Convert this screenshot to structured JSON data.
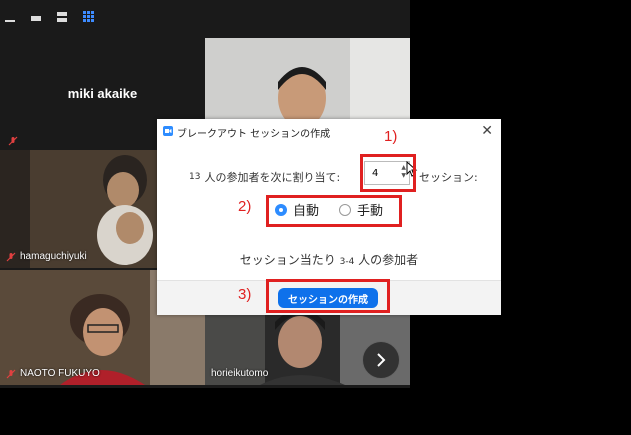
{
  "participants": {
    "tile1_name": "miki akaike",
    "tile2_name": "hamaguchiyuki",
    "tile3_name": "NAOTO FUKUYO",
    "tile4_name": "horieikutomo"
  },
  "dialog": {
    "title": "ブレークアウト セッションの作成",
    "participant_count": "13",
    "assign_text": "人の参加者を次に割り当て:",
    "session_count": "4",
    "sessions_suffix": "セッション:",
    "mode_auto": "自動",
    "mode_manual": "手動",
    "per_session_prefix": "セッション当たり",
    "per_session_range": "3-4",
    "per_session_suffix": "人の参加者",
    "create_button": "セッションの作成",
    "selected_mode": "auto"
  },
  "annotations": {
    "label1": "1)",
    "label2": "2)",
    "label3": "3)",
    "color": "#e02020"
  },
  "colors": {
    "accent": "#0e71eb",
    "radio_on": "#2d8cff"
  },
  "icons": [
    "minimize-icon",
    "restore-icon",
    "speaker-view-icon",
    "gallery-view-icon",
    "mic-muted-icon",
    "zoom-logo-icon",
    "close-icon",
    "chevron-right-icon"
  ]
}
